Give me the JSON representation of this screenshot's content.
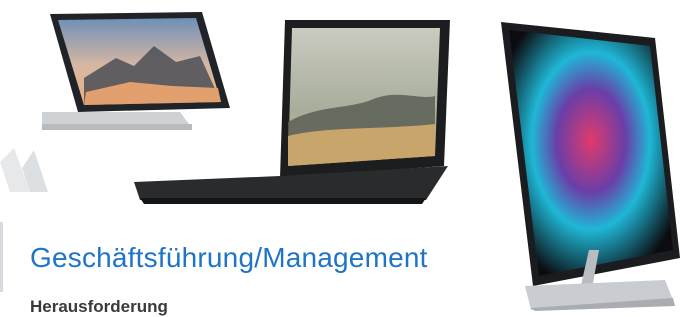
{
  "content": {
    "headline": "Geschäftsführung/Management",
    "subheading": "Herausforderung"
  },
  "images": {
    "devices": [
      {
        "name": "2-in-1 convertible device",
        "icon": "tablet-laptop-icon"
      },
      {
        "name": "black laptop",
        "icon": "laptop-icon"
      },
      {
        "name": "all-in-one studio display",
        "icon": "desktop-monitor-icon"
      }
    ]
  },
  "colors": {
    "headline": "#1f74c6",
    "subheading": "#3a3a3a",
    "background": "#ffffff"
  }
}
